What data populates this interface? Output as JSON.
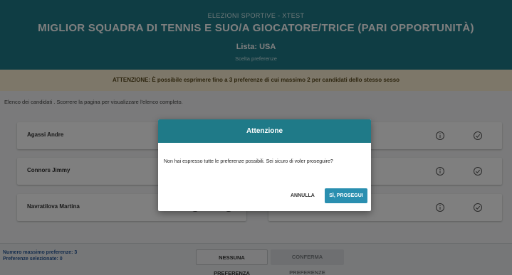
{
  "header": {
    "subtitle": "ELEZIONI SPORTIVE - XTEST",
    "title": "MIGLIOR SQUADRA DI TENNIS E SUO/A GIOCATORE/TRICE (PARI OPPORTUNITÀ)",
    "list": "Lista: USA",
    "hint": "Scelta preferenze"
  },
  "warning": "ATTENZIONE: È possibile esprimere fino a 3 preferenze di cui massimo 2 per candidati dello stesso sesso",
  "instructions": "Elenco dei candidati . Scorrere la pagina per visualizzare l'elenco completo.",
  "candidates": {
    "left": [
      {
        "name": "Agassi Andre"
      },
      {
        "name": "Connors Jimmy"
      },
      {
        "name": "Navratilova Martina"
      }
    ]
  },
  "footer": {
    "max_label": "Numero massimo preferenze: 3",
    "selected_label": "Preferenze selezionate: 0",
    "none_button": "NESSUNA PREFERENZA",
    "confirm_button": "CONFERMA PREFERENZE"
  },
  "modal": {
    "title": "Attenzione",
    "message": "Non hai espresso tutte le preferenze possibili. Sei sicuro di voler proseguire?",
    "cancel": "ANNULLA",
    "proceed": "SÌ, PROSEGUI"
  },
  "colors": {
    "header_bg": "#1f7a88",
    "warning_bg": "#fbefd2",
    "primary_button": "#2a8fb0"
  },
  "icons": {
    "info": "info-circle-icon",
    "check": "check-circle-icon"
  }
}
